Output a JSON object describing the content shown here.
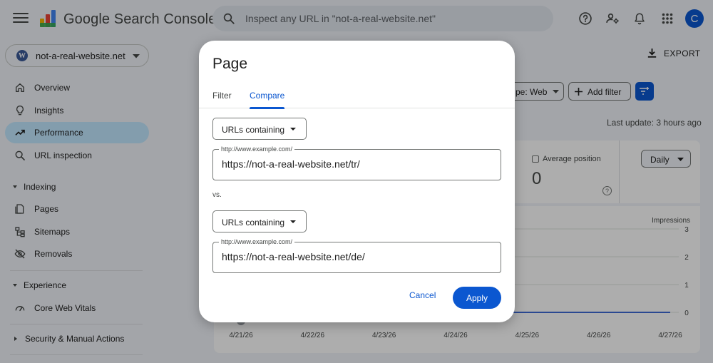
{
  "app": {
    "title": "Google Search Console",
    "avatar_initial": "C"
  },
  "search": {
    "placeholder": "Inspect any URL in \"not-a-real-website.net\""
  },
  "property": {
    "name": "not-a-real-website.net"
  },
  "sidebar": {
    "items": [
      {
        "label": "Overview",
        "icon": "home-icon"
      },
      {
        "label": "Insights",
        "icon": "lightbulb-icon"
      },
      {
        "label": "Performance",
        "icon": "trending-up-icon",
        "active": true
      },
      {
        "label": "URL inspection",
        "icon": "search-icon"
      }
    ],
    "indexing": {
      "heading": "Indexing",
      "items": [
        {
          "label": "Pages",
          "icon": "pages-icon"
        },
        {
          "label": "Sitemaps",
          "icon": "sitemap-icon"
        },
        {
          "label": "Removals",
          "icon": "visibility-off-icon"
        }
      ]
    },
    "experience": {
      "heading": "Experience",
      "items": [
        {
          "label": "Core Web Vitals",
          "icon": "speed-icon"
        }
      ]
    },
    "security": {
      "heading": "Security & Manual Actions"
    }
  },
  "main": {
    "export_label": "EXPORT",
    "search_type_chip": "pe: Web",
    "add_filter_label": "Add filter",
    "last_update": "Last update: 3 hours ago",
    "avg_position": {
      "label": "Average position",
      "value": "0"
    },
    "daily_label": "Daily"
  },
  "chart_data": {
    "type": "line",
    "x": [
      "4/21/26",
      "4/22/26",
      "4/23/26",
      "4/24/26",
      "4/25/26",
      "4/26/26",
      "4/27/26"
    ],
    "y_right_label": "Impressions",
    "y_ticks": [
      "3",
      "2",
      "1",
      "0"
    ],
    "ylim": [
      0,
      3
    ],
    "series": [
      {
        "values": [
          0,
          0,
          0,
          0,
          0,
          0,
          0
        ],
        "color": "#3f6bd6"
      }
    ]
  },
  "dialog": {
    "title": "Page",
    "tabs": [
      {
        "label": "Filter"
      },
      {
        "label": "Compare",
        "active": true
      }
    ],
    "first": {
      "dropdown": "URLs containing",
      "field_label": "http://www.example.com/",
      "value": "https://not-a-real-website.net/tr/"
    },
    "vs_label": "vs.",
    "second": {
      "dropdown": "URLs containing",
      "field_label": "http://www.example.com/",
      "value": "https://not-a-real-website.net/de/"
    },
    "cancel_label": "Cancel",
    "apply_label": "Apply"
  },
  "colors": {
    "accent": "#0b57d0",
    "active_nav": "#c2e7ff",
    "background": "#f1f4f9"
  }
}
